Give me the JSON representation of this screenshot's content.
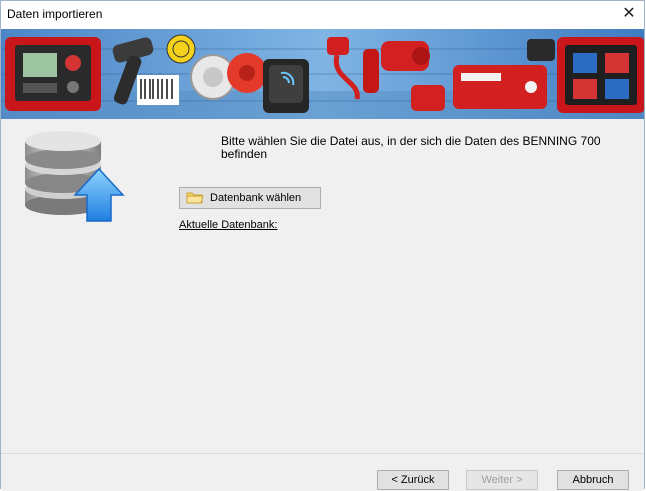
{
  "window": {
    "title": "Daten importieren",
    "close_glyph": "✕"
  },
  "banner": {
    "alt": "product banner",
    "items": [
      "case-icon",
      "scanner-icon",
      "sticker-icon",
      "clamp-icon",
      "rfid-icon",
      "plug-icon",
      "adapter-icon"
    ]
  },
  "main": {
    "instruction": "Bitte wählen Sie die Datei aus, in der sich die Daten des BENNING 700 befinden",
    "choose_db_label": "Datenbank wählen",
    "current_db_label": "Aktuelle Datenbank:"
  },
  "footer": {
    "back_label": "< Zurück",
    "next_label": "Weiter >",
    "cancel_label": "Abbruch"
  },
  "colors": {
    "accent": "#e21b1b",
    "window_bg": "#f0f0f0",
    "button_bg": "#e1e1e1"
  }
}
